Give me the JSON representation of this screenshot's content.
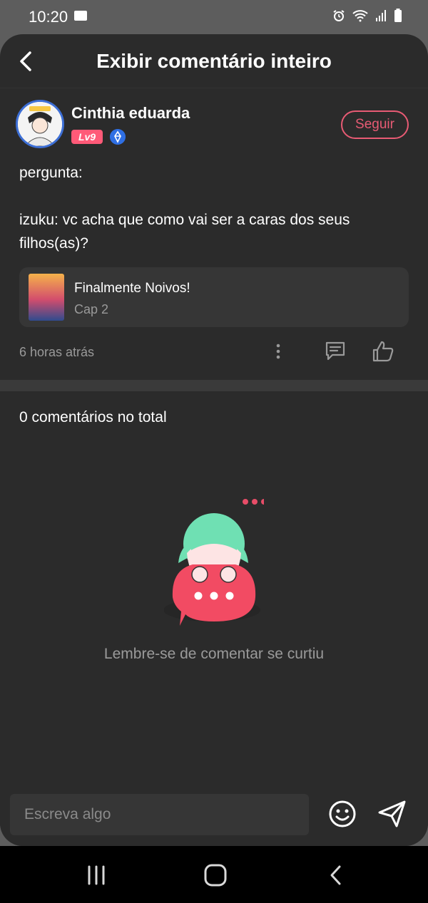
{
  "status_bar": {
    "time": "10:20",
    "icons": [
      "folder-icon",
      "alarm-icon",
      "wifi-icon",
      "signal-icon",
      "battery-icon"
    ]
  },
  "header": {
    "title": "Exibir comentário inteiro",
    "back_icon": "chevron-left-icon"
  },
  "comment": {
    "author": "Cinthia eduarda",
    "level": "Lv9",
    "follow_label": "Seguir",
    "text": "pergunta:\n\nizuku: vc acha que como vai ser a caras dos seus filhos(as)?",
    "book": {
      "title": "Finalmente Noivos!",
      "chapter": "Cap 2"
    },
    "time_ago": "6 horas atrás"
  },
  "replies": {
    "total_label": "0 comentários no total",
    "empty_message": "Lembre-se de comentar se curtiu"
  },
  "composer": {
    "placeholder": "Escreva algo"
  },
  "colors": {
    "background": "#2b2b2b",
    "accent": "#e85b74",
    "level_badge": "#ff5a78",
    "muted_text": "#9a9a9a"
  }
}
